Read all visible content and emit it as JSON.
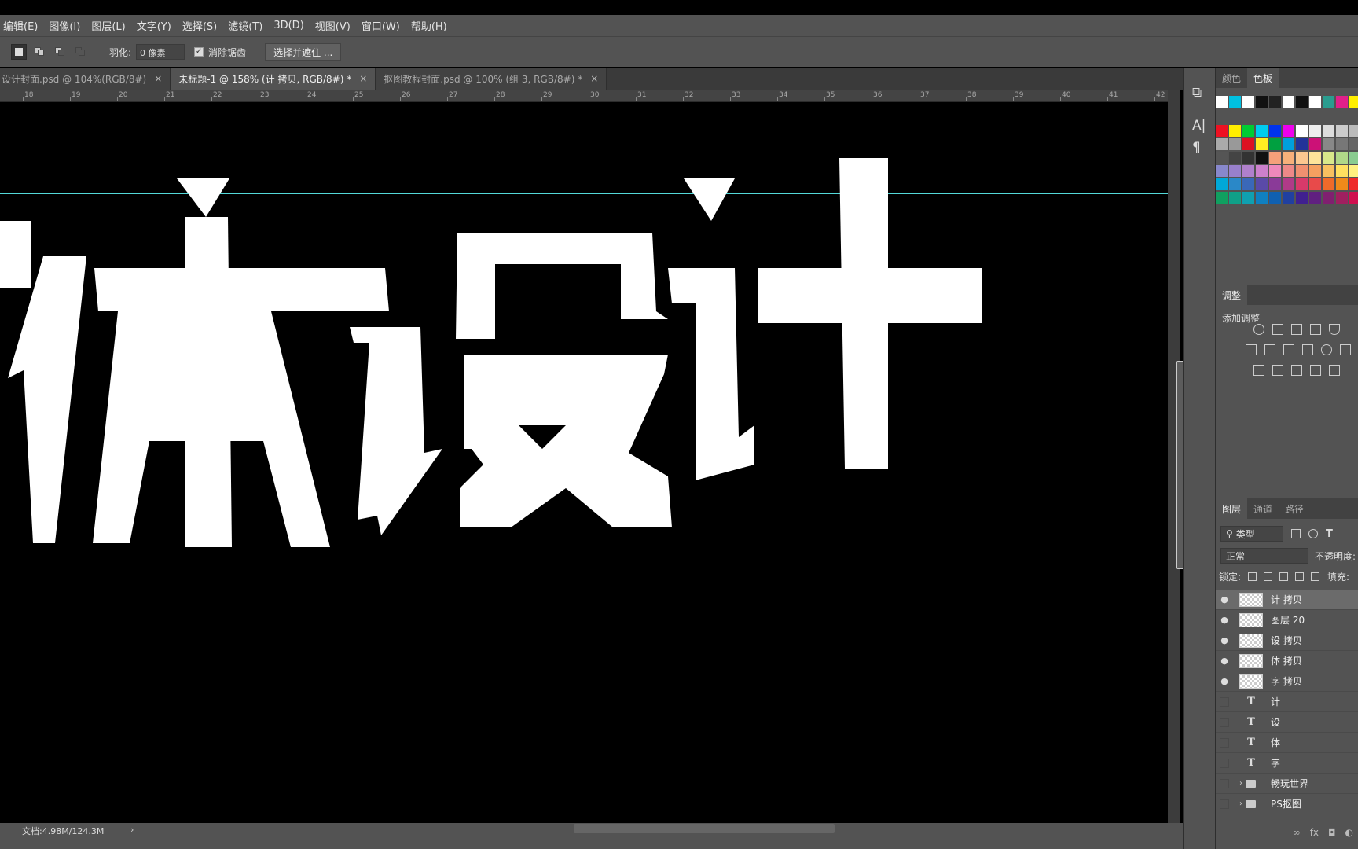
{
  "menu": [
    "编辑(E)",
    "图像(I)",
    "图层(L)",
    "文字(Y)",
    "选择(S)",
    "滤镜(T)",
    "3D(D)",
    "视图(V)",
    "窗口(W)",
    "帮助(H)"
  ],
  "options": {
    "feather_label": "羽化:",
    "feather_value": "0 像素",
    "antialias_label": "消除锯齿",
    "select_mask_button": "选择并遮住 ..."
  },
  "tabs": [
    {
      "label": "设计封面.psd @ 104%(RGB/8#)",
      "active": false
    },
    {
      "label": "未标题-1 @ 158% (计 拷贝, RGB/8#) *",
      "active": true
    },
    {
      "label": "抠图教程封面.psd @ 100% (组 3, RGB/8#) *",
      "active": false
    }
  ],
  "ruler_ticks": [
    "18",
    "19",
    "20",
    "21",
    "22",
    "23",
    "24",
    "25",
    "26",
    "27",
    "28",
    "29",
    "30",
    "31",
    "32",
    "33",
    "34",
    "35",
    "36",
    "37",
    "38",
    "39",
    "40",
    "41",
    "42"
  ],
  "status": {
    "doc_size": "文档:4.98M/124.3M"
  },
  "color_panel": {
    "tabs": [
      "颜色",
      "色板"
    ],
    "active_tab": "色板"
  },
  "adjustments": {
    "title": "调整",
    "subtitle": "添加调整"
  },
  "layers_panel": {
    "tabs": [
      "图层",
      "通道",
      "路径"
    ],
    "filter_kind": "类型",
    "blend_mode": "正常",
    "opacity_label": "不透明度:",
    "lock_label": "锁定:",
    "fill_label": "填充:",
    "layers": [
      {
        "name": "计 拷贝",
        "kind": "pixel",
        "visible": true,
        "selected": true
      },
      {
        "name": "图层 20",
        "kind": "pixel",
        "visible": true,
        "selected": false
      },
      {
        "name": "设 拷贝",
        "kind": "pixel",
        "visible": true,
        "selected": false
      },
      {
        "name": "体 拷贝",
        "kind": "pixel",
        "visible": true,
        "selected": false
      },
      {
        "name": "字 拷贝",
        "kind": "pixel",
        "visible": true,
        "selected": false
      },
      {
        "name": "计",
        "kind": "text",
        "visible": false,
        "selected": false
      },
      {
        "name": "设",
        "kind": "text",
        "visible": false,
        "selected": false
      },
      {
        "name": "体",
        "kind": "text",
        "visible": false,
        "selected": false
      },
      {
        "name": "字",
        "kind": "text",
        "visible": false,
        "selected": false
      },
      {
        "name": "畅玩世界",
        "kind": "group",
        "visible": false,
        "selected": false
      },
      {
        "name": "PS抠图",
        "kind": "group",
        "visible": false,
        "selected": false
      }
    ]
  },
  "colors": {
    "canvas_bg": "#000000",
    "guide": "#53d9d9",
    "ui_panel": "#535353"
  }
}
